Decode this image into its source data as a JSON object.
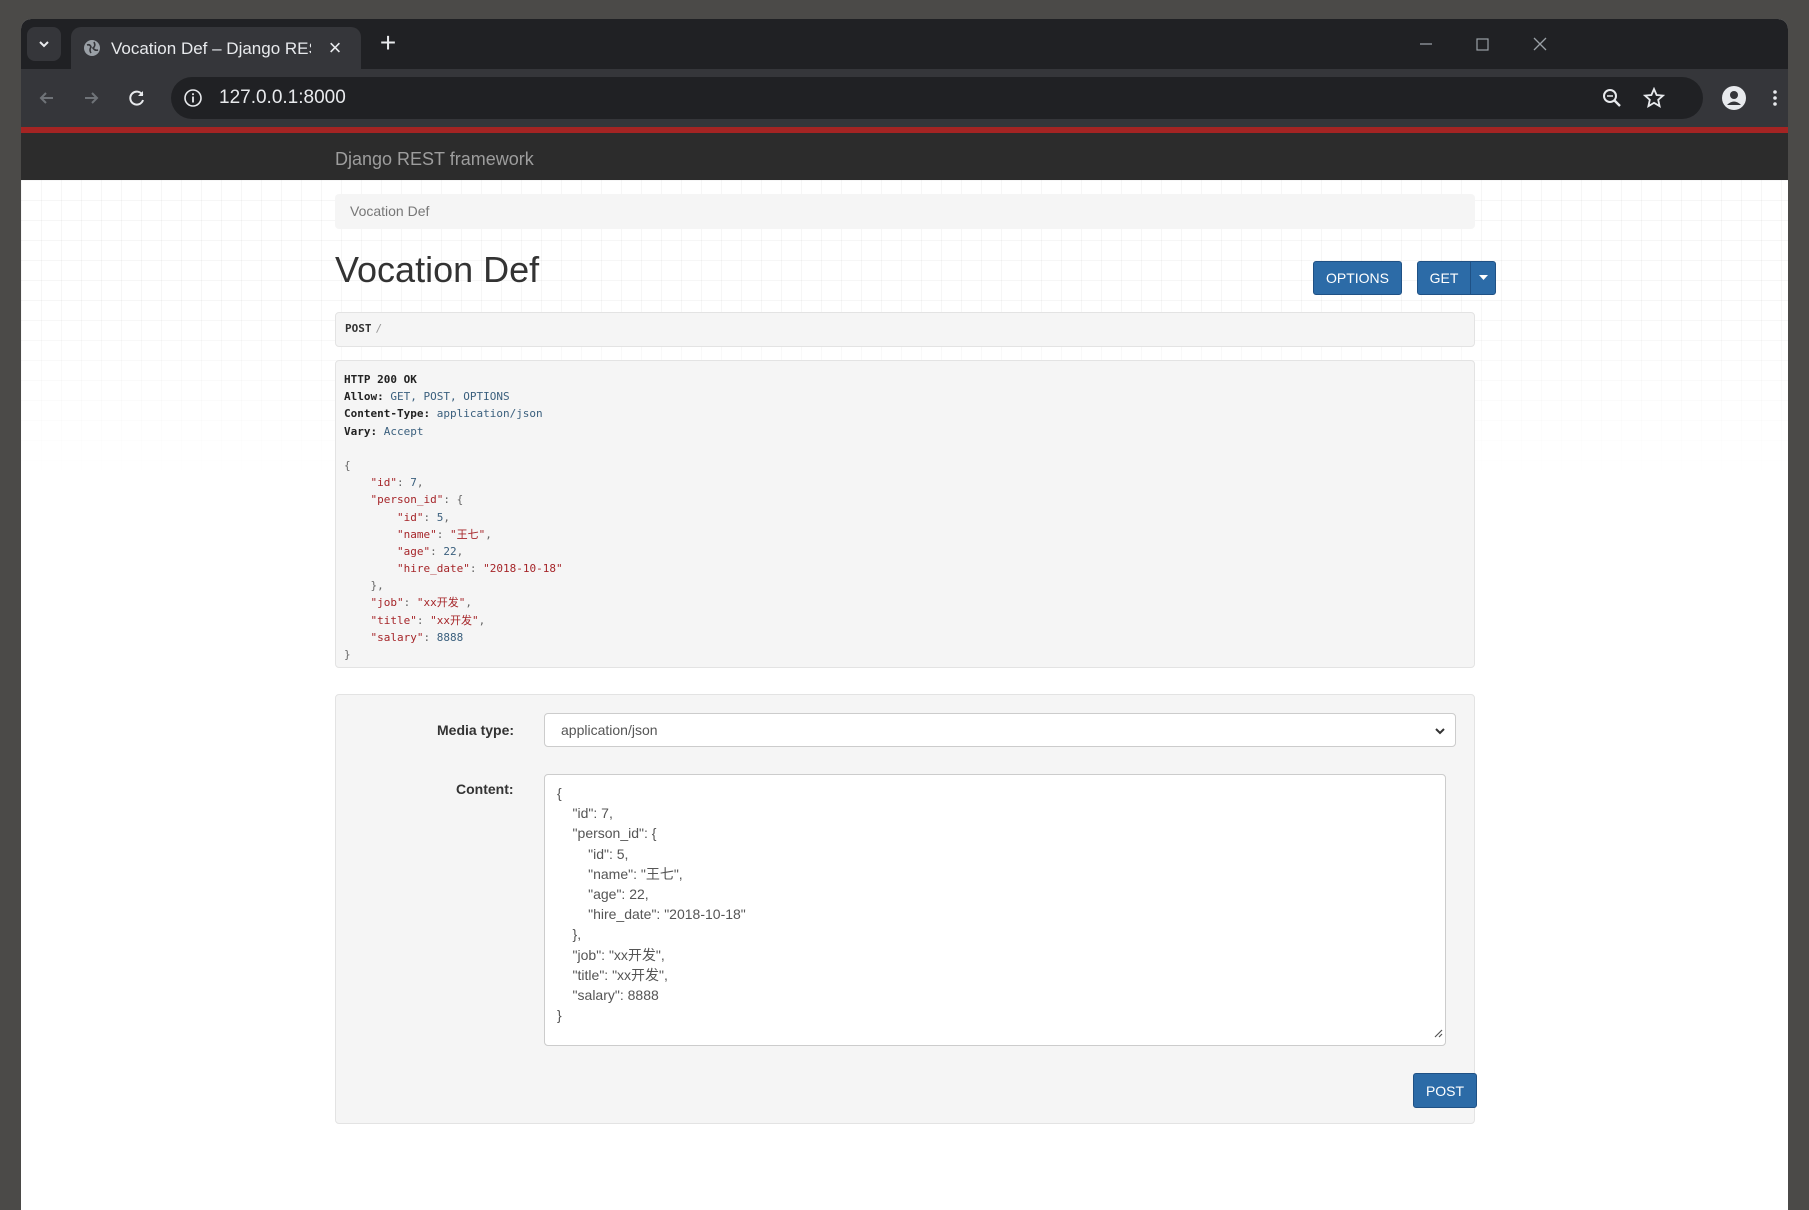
{
  "browser": {
    "tab_title": "Vocation Def – Django REST framework",
    "tab_close": "×",
    "new_tab": "+",
    "url": "127.0.0.1:8000"
  },
  "navbar": {
    "brand": "Django REST framework"
  },
  "breadcrumb": {
    "item": "Vocation Def"
  },
  "page": {
    "title": "Vocation Def",
    "options_label": "OPTIONS",
    "get_label": "GET"
  },
  "request": {
    "method": "POST",
    "path": "/"
  },
  "response": {
    "status": "HTTP 200 OK",
    "headers": [
      {
        "name": "Allow:",
        "value": "GET, POST, OPTIONS"
      },
      {
        "name": "Content-Type:",
        "value": "application/json"
      },
      {
        "name": "Vary:",
        "value": "Accept"
      }
    ],
    "body": {
      "id_key": "\"id\"",
      "id_val": "7",
      "person_key": "\"person_id\"",
      "pid_key": "\"id\"",
      "pid_val": "5",
      "name_key": "\"name\"",
      "name_val": "\"王七\"",
      "age_key": "\"age\"",
      "age_val": "22",
      "hire_key": "\"hire_date\"",
      "hire_val": "\"2018-10-18\"",
      "job_key": "\"job\"",
      "job_val": "\"xx开发\"",
      "title_key": "\"title\"",
      "title_val": "\"xx开发\"",
      "salary_key": "\"salary\"",
      "salary_val": "8888"
    }
  },
  "form": {
    "media_type_label": "Media type:",
    "media_type_value": "application/json",
    "content_label": "Content:",
    "content_lines": [
      "{",
      "    \"id\": 7,",
      "    \"person_id\": {",
      "        \"id\": 5,",
      "        \"name\": \"王七\",",
      "        \"age\": 22,",
      "        \"hire_date\": \"2018-10-18\"",
      "    },",
      "    \"job\": \"xx开发\",",
      "    \"title\": \"xx开发\",",
      "    \"salary\": 8888",
      "}"
    ],
    "post_label": "POST"
  },
  "colors": {
    "navbar_bg": "#2c2c2c",
    "navbar_accent": "#a42423",
    "button_primary": "#2c6ba7",
    "json_key": "#a6262a",
    "json_number": "#3a5f7d"
  }
}
